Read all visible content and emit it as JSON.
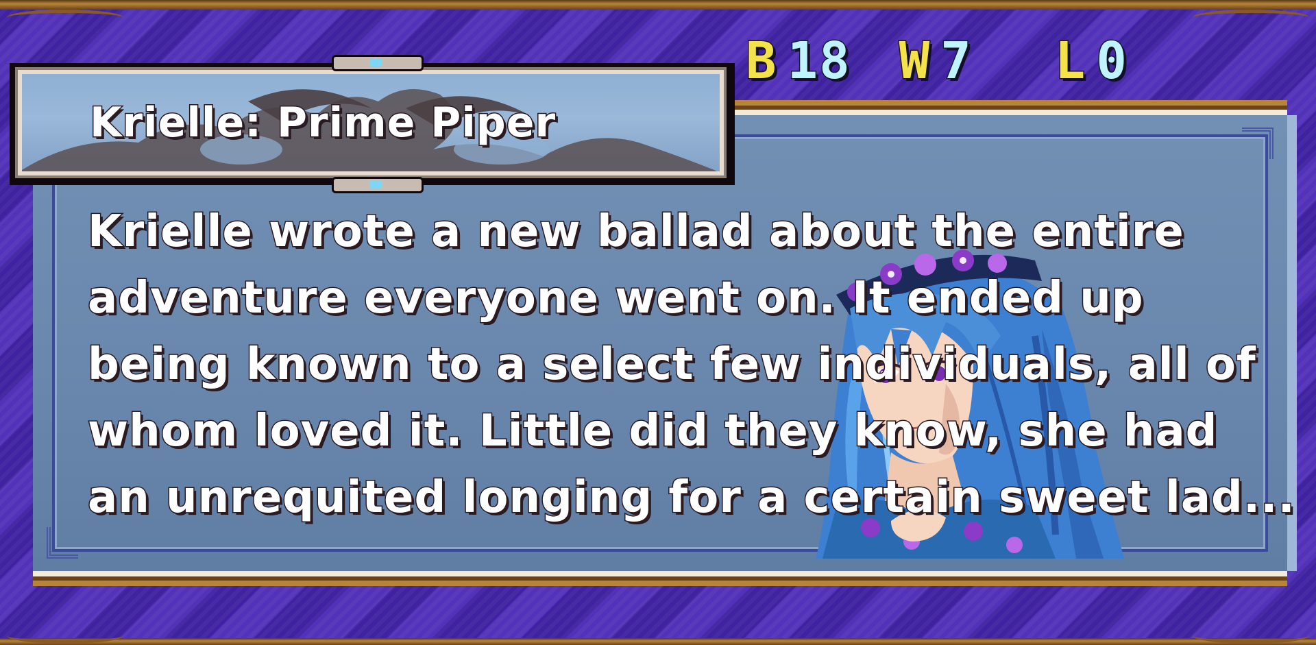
{
  "stats": {
    "b_key": "B",
    "b_value": "18",
    "w_key": "W",
    "w_value": "7",
    "l_key": "L",
    "l_value": "0"
  },
  "title": "Krielle: Prime Piper",
  "description": {
    "lines": [
      "Krielle wrote a new ballad about the entire",
      "adventure everyone went on. It ended up",
      "being known to a select few individuals, all of",
      "whom loved it. Little did they know, she had",
      "an unrequited longing for a certain sweet lad..."
    ]
  },
  "colors": {
    "background_stripe_dark": "#3e22a0",
    "background_stripe_light": "#5232b8",
    "panel_blue": "#6a88ad",
    "gold_trim": "#b8843a",
    "stat_key_yellow": "#f4e24a",
    "stat_value_cyan": "#bff4ff",
    "hair_blue": "#4a8fd8"
  },
  "icons": {
    "title_ornament": "jewel-ornament-icon",
    "decorative_dragon": "dragon-silhouette-icon"
  }
}
